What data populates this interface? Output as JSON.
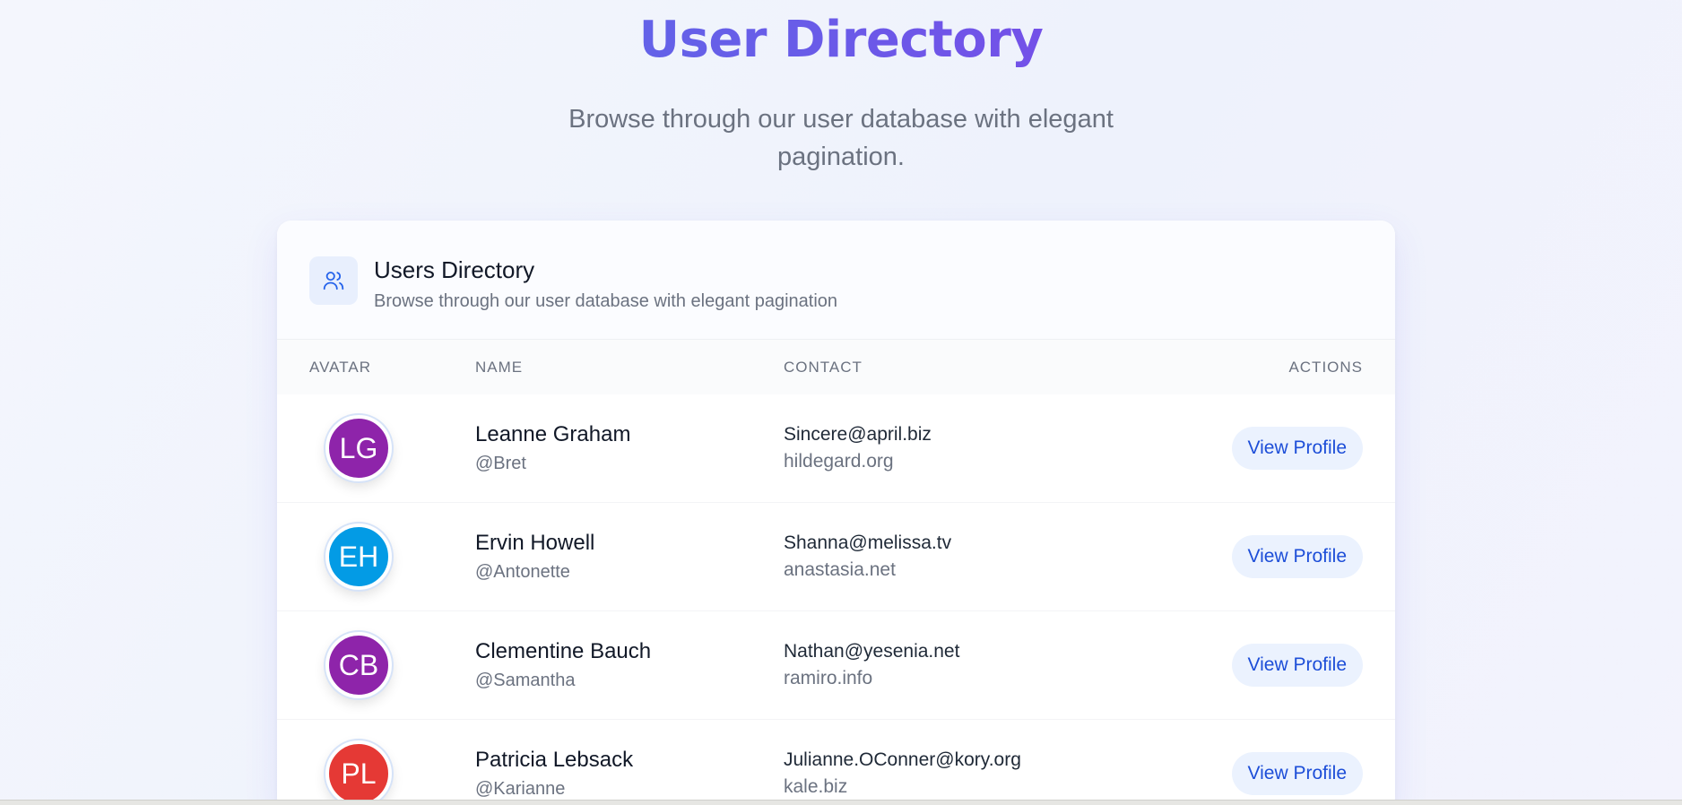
{
  "hero": {
    "title": "User Directory",
    "subtitle": "Browse through our user database with elegant pagination."
  },
  "card": {
    "title": "Users Directory",
    "subtitle": "Browse through our user database with elegant pagination",
    "icon": "users-icon"
  },
  "table": {
    "headers": [
      "AVATAR",
      "NAME",
      "CONTACT",
      "ACTIONS"
    ],
    "rows": [
      {
        "initials": "LG",
        "color": "#8e24aa",
        "name": "Leanne Graham",
        "username": "@Bret",
        "email": "Sincere@april.biz",
        "website": "hildegard.org",
        "action": "View Profile"
      },
      {
        "initials": "EH",
        "color": "#039be5",
        "name": "Ervin Howell",
        "username": "@Antonette",
        "email": "Shanna@melissa.tv",
        "website": "anastasia.net",
        "action": "View Profile"
      },
      {
        "initials": "CB",
        "color": "#8e24aa",
        "name": "Clementine Bauch",
        "username": "@Samantha",
        "email": "Nathan@yesenia.net",
        "website": "ramiro.info",
        "action": "View Profile"
      },
      {
        "initials": "PL",
        "color": "#e53935",
        "name": "Patricia Lebsack",
        "username": "@Karianne",
        "email": "Julianne.OConner@kory.org",
        "website": "kale.biz",
        "action": "View Profile"
      }
    ]
  },
  "colors": {
    "accent": "#1d4ed8",
    "title_gradient_start": "#4f7bea",
    "title_gradient_end": "#9233e8"
  }
}
